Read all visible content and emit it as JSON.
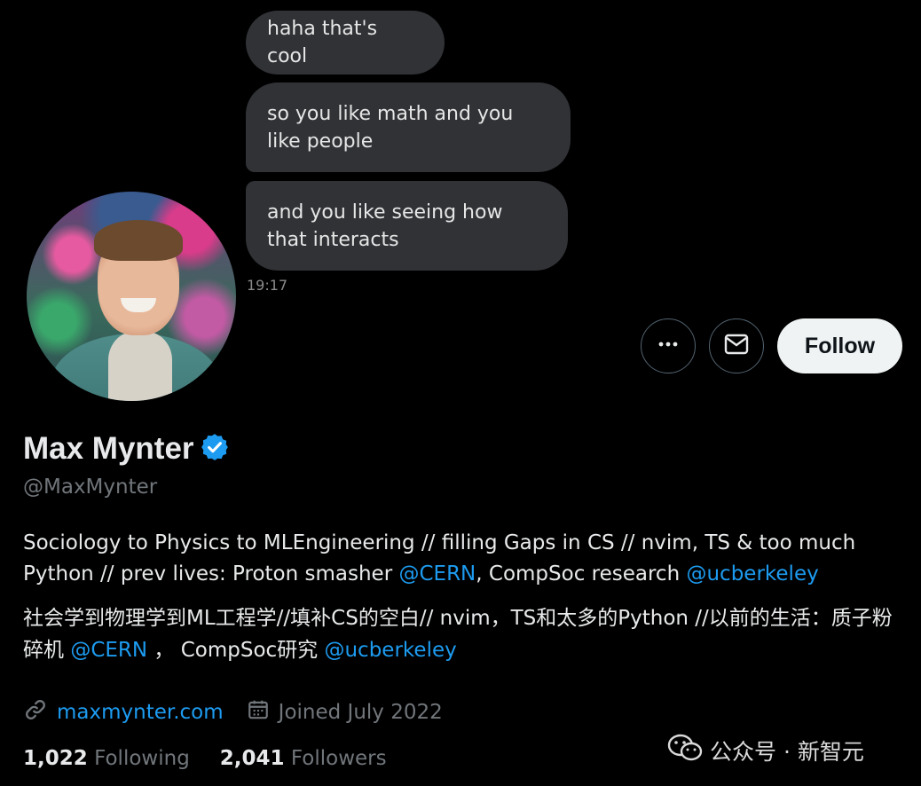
{
  "chat": {
    "messages": [
      {
        "text": "haha that's cool"
      },
      {
        "text": "so you like math and you like people"
      },
      {
        "text": "and you like seeing how that interacts"
      }
    ],
    "timestamp": "19:17"
  },
  "actions": {
    "more_icon": "more-horizontal-icon",
    "message_icon": "envelope-icon",
    "follow_label": "Follow"
  },
  "profile": {
    "name": "Max Mynter",
    "verified_icon": "verified-badge-icon",
    "handle": "@MaxMynter",
    "bio_en": {
      "part1": "Sociology to Physics to MLEngineering // filling Gaps in CS // nvim, TS & too much Python // prev lives: Proton smasher ",
      "mention1": "@CERN",
      "part2": ", CompSoc research ",
      "mention2": "@ucberkeley"
    },
    "bio_zh": {
      "part1": "社会学到物理学到ML工程学//填补CS的空白// nvim，TS和太多的Python //以前的生活：质子粉碎机 ",
      "mention1": "@CERN",
      "part2": " ， CompSoc研究 ",
      "mention2": "@ucberkeley"
    },
    "website": "maxmynter.com",
    "joined": "Joined July 2022",
    "link_icon": "link-icon",
    "calendar_icon": "calendar-icon"
  },
  "stats": {
    "following_count": "1,022",
    "following_label": "Following",
    "followers_count": "2,041",
    "followers_label": "Followers"
  },
  "watermark": {
    "text": "公众号 · 新智元",
    "icon": "wechat-icon"
  },
  "colors": {
    "accent": "#1d9bf0",
    "bubble": "#303236",
    "muted": "#71767b"
  }
}
